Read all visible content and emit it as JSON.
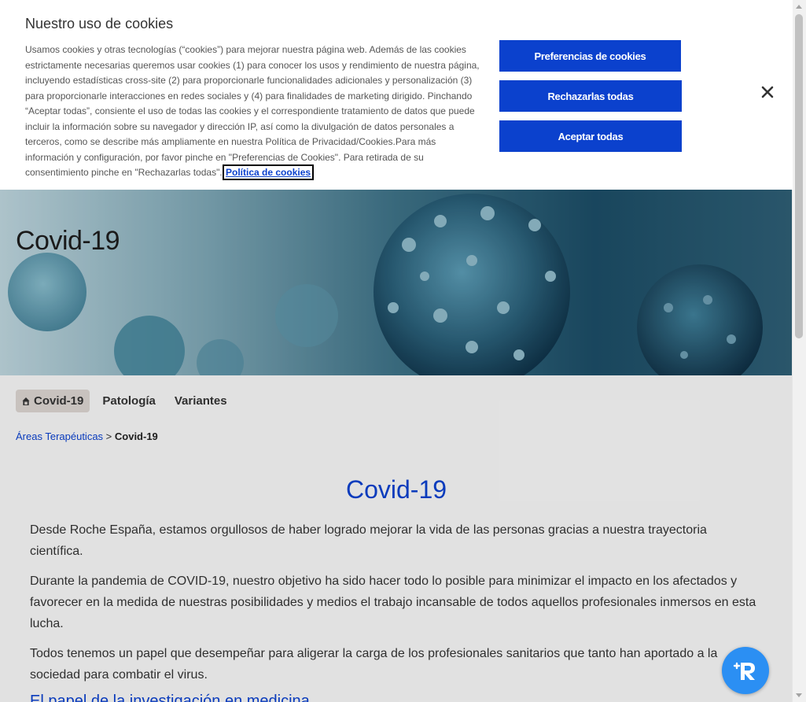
{
  "cookie_banner": {
    "title": "Nuestro uso de cookies",
    "text": "Usamos cookies y otras tecnologías (“cookies”) para mejorar nuestra página web. Además de las cookies estrictamente necesarias queremos usar cookies (1) para conocer los usos y rendimiento de nuestra página, incluyendo estadísticas cross-site (2) para proporcionarle funcionalidades adicionales y personalización (3) para proporcionarle interacciones en redes sociales y (4) para finalidades de marketing dirigido. Pinchando “Aceptar todas”, consiente el uso de todas las cookies y el correspondiente tratamiento de datos que puede incluir la información sobre su navegador y dirección IP, así como la divulgación de datos personales a terceros, como se describe más ampliamente en nuestra Política de Privacidad/Cookies.Para más información y configuración, por favor pinche en \"Preferencias de Cookies\". Para retirada de su consentimiento pinche en \"Rechazarlas todas\".",
    "policy_link": "Política de cookies",
    "buttons": {
      "preferences": "Preferencias de cookies",
      "reject": "Rechazarlas todas",
      "accept": "Aceptar todas"
    },
    "close_icon": "close-icon"
  },
  "hero": {
    "title": "Covid-19"
  },
  "subnav": {
    "tabs": [
      {
        "label": "Covid-19",
        "active": true,
        "icon": "home-icon"
      },
      {
        "label": "Patología"
      },
      {
        "label": "Variantes"
      }
    ]
  },
  "breadcrumb": {
    "parent": "Áreas Terapéuticas",
    "separator": ">",
    "current": "Covid-19"
  },
  "main": {
    "heading": "Covid-19",
    "paragraphs": [
      "Desde Roche España, estamos orgullosos de haber logrado mejorar la vida de las personas gracias a nuestra trayectoria científica.",
      "Durante la pandemia de COVID-19, nuestro objetivo ha sido hacer todo lo posible para minimizar el impacto en los afectados y favorecer en la medida de nuestras posibilidades y medios el trabajo incansable de todos aquellos profesionales inmersos en esta lucha.",
      "Todos tenemos un papel que desempeñar para aligerar la carga de los profesionales sanitarios que tanto han aportado a la sociedad para combatir el virus."
    ],
    "partial_link": "El papel de la investigación en medicina"
  },
  "widget": {
    "icon": "accessibility-widget-icon",
    "color": "#2b8ff3"
  },
  "colors": {
    "brand_blue": "#0b41cd"
  }
}
